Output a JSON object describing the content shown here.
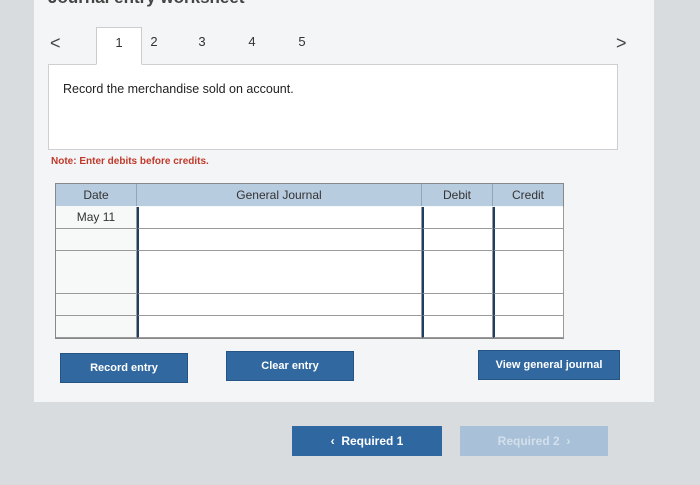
{
  "header": {
    "title": "Journal entry worksheet"
  },
  "tabs": {
    "prev_arrow": "<",
    "next_arrow": ">",
    "items": [
      "1",
      "2",
      "3",
      "4",
      "5"
    ],
    "active": "1"
  },
  "prompt": {
    "text": "Record the merchandise sold on account."
  },
  "note": "Note: Enter debits before credits.",
  "table": {
    "headers": {
      "date": "Date",
      "journal": "General Journal",
      "debit": "Debit",
      "credit": "Credit"
    },
    "rows": [
      {
        "date": "May 11",
        "journal": "",
        "debit": "",
        "credit": ""
      },
      {
        "date": "",
        "journal": "",
        "debit": "",
        "credit": ""
      },
      {
        "date": "",
        "journal": "",
        "debit": "",
        "credit": ""
      },
      {
        "date": "",
        "journal": "",
        "debit": "",
        "credit": ""
      },
      {
        "date": "",
        "journal": "",
        "debit": "",
        "credit": ""
      },
      {
        "date": "",
        "journal": "",
        "debit": "",
        "credit": ""
      }
    ]
  },
  "buttons": {
    "record": "Record entry",
    "clear": "Clear entry",
    "view": "View general journal"
  },
  "footer": {
    "prev_label": "Required 1",
    "next_label": "Required 2"
  },
  "colors": {
    "accent": "#3168a0",
    "header_bg": "#b8cce0",
    "note": "#c0392b"
  }
}
